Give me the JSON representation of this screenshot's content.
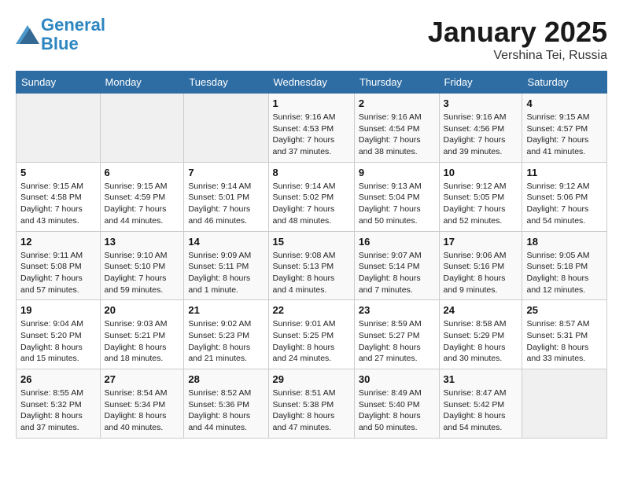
{
  "header": {
    "logo_line1": "General",
    "logo_line2": "Blue",
    "month": "January 2025",
    "location": "Vershina Tei, Russia"
  },
  "weekdays": [
    "Sunday",
    "Monday",
    "Tuesday",
    "Wednesday",
    "Thursday",
    "Friday",
    "Saturday"
  ],
  "weeks": [
    [
      {
        "day": "",
        "info": ""
      },
      {
        "day": "",
        "info": ""
      },
      {
        "day": "",
        "info": ""
      },
      {
        "day": "1",
        "info": "Sunrise: 9:16 AM\nSunset: 4:53 PM\nDaylight: 7 hours and 37 minutes."
      },
      {
        "day": "2",
        "info": "Sunrise: 9:16 AM\nSunset: 4:54 PM\nDaylight: 7 hours and 38 minutes."
      },
      {
        "day": "3",
        "info": "Sunrise: 9:16 AM\nSunset: 4:56 PM\nDaylight: 7 hours and 39 minutes."
      },
      {
        "day": "4",
        "info": "Sunrise: 9:15 AM\nSunset: 4:57 PM\nDaylight: 7 hours and 41 minutes."
      }
    ],
    [
      {
        "day": "5",
        "info": "Sunrise: 9:15 AM\nSunset: 4:58 PM\nDaylight: 7 hours and 43 minutes."
      },
      {
        "day": "6",
        "info": "Sunrise: 9:15 AM\nSunset: 4:59 PM\nDaylight: 7 hours and 44 minutes."
      },
      {
        "day": "7",
        "info": "Sunrise: 9:14 AM\nSunset: 5:01 PM\nDaylight: 7 hours and 46 minutes."
      },
      {
        "day": "8",
        "info": "Sunrise: 9:14 AM\nSunset: 5:02 PM\nDaylight: 7 hours and 48 minutes."
      },
      {
        "day": "9",
        "info": "Sunrise: 9:13 AM\nSunset: 5:04 PM\nDaylight: 7 hours and 50 minutes."
      },
      {
        "day": "10",
        "info": "Sunrise: 9:12 AM\nSunset: 5:05 PM\nDaylight: 7 hours and 52 minutes."
      },
      {
        "day": "11",
        "info": "Sunrise: 9:12 AM\nSunset: 5:06 PM\nDaylight: 7 hours and 54 minutes."
      }
    ],
    [
      {
        "day": "12",
        "info": "Sunrise: 9:11 AM\nSunset: 5:08 PM\nDaylight: 7 hours and 57 minutes."
      },
      {
        "day": "13",
        "info": "Sunrise: 9:10 AM\nSunset: 5:10 PM\nDaylight: 7 hours and 59 minutes."
      },
      {
        "day": "14",
        "info": "Sunrise: 9:09 AM\nSunset: 5:11 PM\nDaylight: 8 hours and 1 minute."
      },
      {
        "day": "15",
        "info": "Sunrise: 9:08 AM\nSunset: 5:13 PM\nDaylight: 8 hours and 4 minutes."
      },
      {
        "day": "16",
        "info": "Sunrise: 9:07 AM\nSunset: 5:14 PM\nDaylight: 8 hours and 7 minutes."
      },
      {
        "day": "17",
        "info": "Sunrise: 9:06 AM\nSunset: 5:16 PM\nDaylight: 8 hours and 9 minutes."
      },
      {
        "day": "18",
        "info": "Sunrise: 9:05 AM\nSunset: 5:18 PM\nDaylight: 8 hours and 12 minutes."
      }
    ],
    [
      {
        "day": "19",
        "info": "Sunrise: 9:04 AM\nSunset: 5:20 PM\nDaylight: 8 hours and 15 minutes."
      },
      {
        "day": "20",
        "info": "Sunrise: 9:03 AM\nSunset: 5:21 PM\nDaylight: 8 hours and 18 minutes."
      },
      {
        "day": "21",
        "info": "Sunrise: 9:02 AM\nSunset: 5:23 PM\nDaylight: 8 hours and 21 minutes."
      },
      {
        "day": "22",
        "info": "Sunrise: 9:01 AM\nSunset: 5:25 PM\nDaylight: 8 hours and 24 minutes."
      },
      {
        "day": "23",
        "info": "Sunrise: 8:59 AM\nSunset: 5:27 PM\nDaylight: 8 hours and 27 minutes."
      },
      {
        "day": "24",
        "info": "Sunrise: 8:58 AM\nSunset: 5:29 PM\nDaylight: 8 hours and 30 minutes."
      },
      {
        "day": "25",
        "info": "Sunrise: 8:57 AM\nSunset: 5:31 PM\nDaylight: 8 hours and 33 minutes."
      }
    ],
    [
      {
        "day": "26",
        "info": "Sunrise: 8:55 AM\nSunset: 5:32 PM\nDaylight: 8 hours and 37 minutes."
      },
      {
        "day": "27",
        "info": "Sunrise: 8:54 AM\nSunset: 5:34 PM\nDaylight: 8 hours and 40 minutes."
      },
      {
        "day": "28",
        "info": "Sunrise: 8:52 AM\nSunset: 5:36 PM\nDaylight: 8 hours and 44 minutes."
      },
      {
        "day": "29",
        "info": "Sunrise: 8:51 AM\nSunset: 5:38 PM\nDaylight: 8 hours and 47 minutes."
      },
      {
        "day": "30",
        "info": "Sunrise: 8:49 AM\nSunset: 5:40 PM\nDaylight: 8 hours and 50 minutes."
      },
      {
        "day": "31",
        "info": "Sunrise: 8:47 AM\nSunset: 5:42 PM\nDaylight: 8 hours and 54 minutes."
      },
      {
        "day": "",
        "info": ""
      }
    ]
  ]
}
